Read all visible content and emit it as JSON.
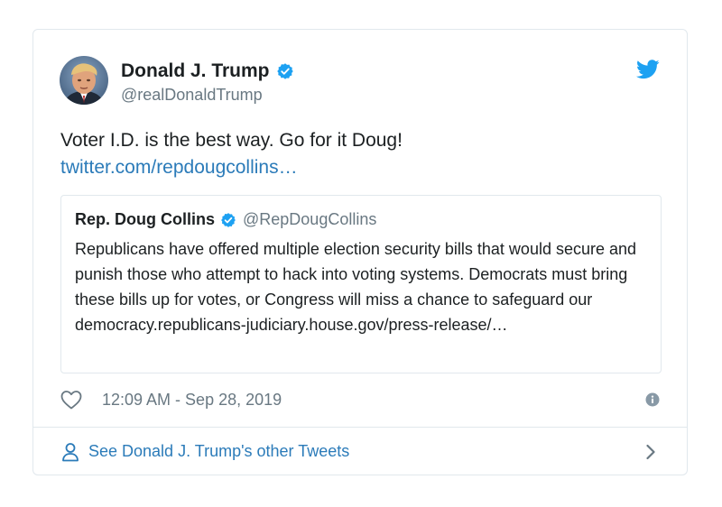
{
  "tweet": {
    "author": {
      "display_name": "Donald J. Trump",
      "handle": "@realDonaldTrump",
      "verified": true,
      "avatar": "avatar-photo"
    },
    "text": "Voter I.D. is the best way. Go for it Doug!",
    "link_text": "twitter.com/repdougcollins…",
    "timestamp": "12:09 AM - Sep 28, 2019"
  },
  "quoted_tweet": {
    "display_name": "Rep. Doug Collins",
    "handle": "@RepDougCollins",
    "verified": true,
    "text": "Republicans have offered multiple election security bills that would secure and punish those who attempt to hack into voting systems. Democrats must bring these bills up for votes, or Congress will miss a chance to safeguard our democracy.republicans-judiciary.house.gov/press-release/…"
  },
  "footer": {
    "label": "See Donald J. Trump's other Tweets"
  },
  "icons": {
    "brand": "twitter-bird-icon",
    "verified": "verified-badge-icon",
    "like": "heart-icon",
    "info": "info-icon",
    "profile": "person-icon",
    "next": "chevron-right-icon"
  },
  "colors": {
    "link": "#2b7bb9",
    "brand": "#1da1f2",
    "secondary_text": "#697882",
    "border": "#e1e8ed"
  }
}
